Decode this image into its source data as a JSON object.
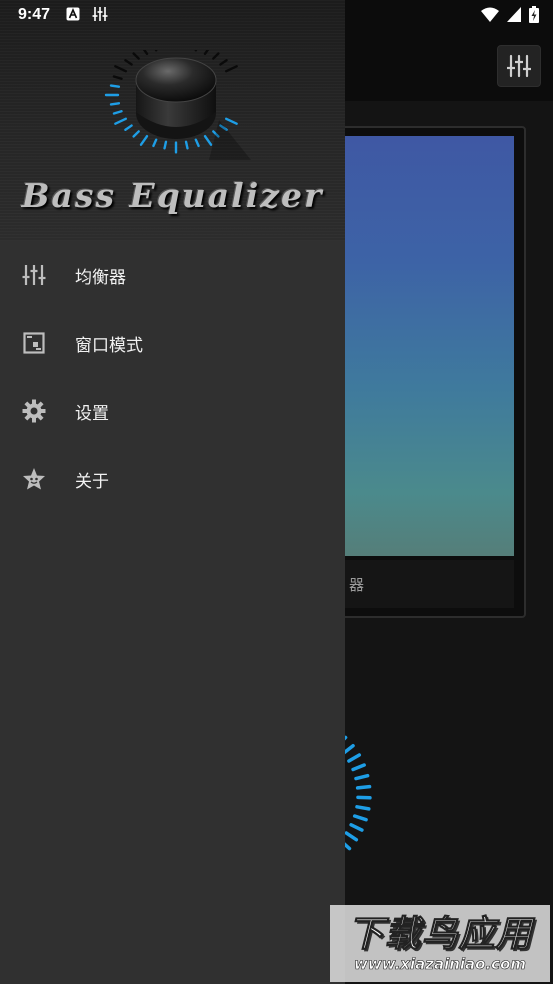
{
  "status_bar": {
    "time": "9:47",
    "left_icons": [
      "a-notification-icon",
      "equalizer-notification-icon"
    ],
    "right_icons": [
      "wifi-icon",
      "signal-icon",
      "battery-charging-icon"
    ]
  },
  "drawer": {
    "brand": "Bass Equalizer",
    "knob_accent": "#1e9ee6",
    "items": [
      {
        "label": "均衡器",
        "icon": "equalizer-icon"
      },
      {
        "label": "窗口模式",
        "icon": "window-mode-icon"
      },
      {
        "label": "设置",
        "icon": "gear-icon"
      },
      {
        "label": "关于",
        "icon": "star-face-icon"
      }
    ]
  },
  "background": {
    "card_caption": "器"
  },
  "watermark": {
    "main": "下载鸟应用",
    "url": "www.xiazainiao.com"
  }
}
